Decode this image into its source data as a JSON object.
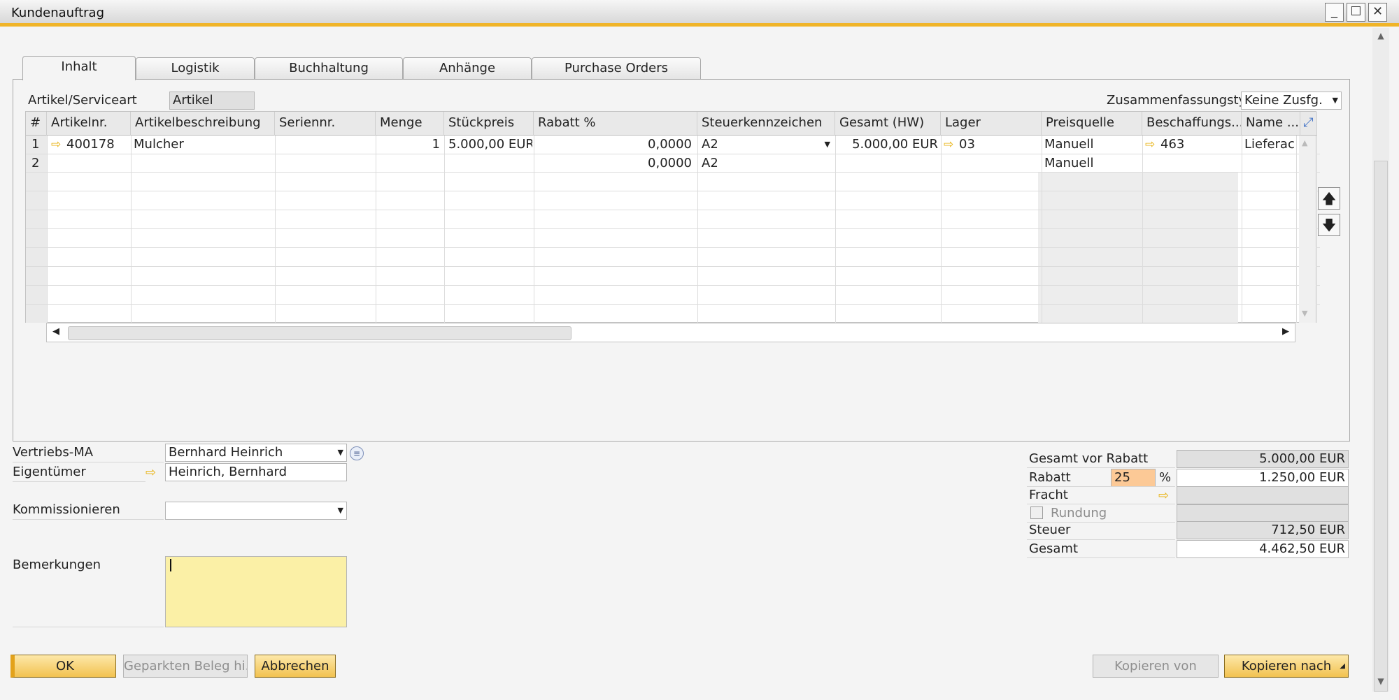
{
  "window": {
    "title": "Kundenauftrag"
  },
  "tabs": [
    {
      "label": "Inhalt"
    },
    {
      "label": "Logistik"
    },
    {
      "label": "Buchhaltung"
    },
    {
      "label": "Anhänge"
    },
    {
      "label": "Purchase Orders"
    }
  ],
  "header": {
    "item_type_label": "Artikel/Serviceart",
    "item_type_value": "Artikel",
    "summary_type_label": "Zusammenfassungstyp",
    "summary_type_value": "Keine Zusfg."
  },
  "grid": {
    "columns": [
      "#",
      "Artikelnr.",
      "Artikelbeschreibung",
      "Seriennr.",
      "Menge",
      "Stückpreis",
      "Rabatt %",
      "Steuerkennzeichen",
      "Gesamt (HW)",
      "Lager",
      "Preisquelle",
      "Beschaffungs...",
      "Name ..."
    ],
    "rows": [
      {
        "num": "1",
        "item_no": "400178",
        "description": "Mulcher",
        "serial": "",
        "qty": "1",
        "price": "5.000,00 EUR",
        "discount": "0,0000",
        "tax": "A2",
        "total": "5.000,00 EUR",
        "warehouse": "03",
        "price_source": "Manuell",
        "procurement": "463",
        "name": "Lieferac"
      },
      {
        "num": "2",
        "item_no": "",
        "description": "",
        "serial": "",
        "qty": "",
        "price": "",
        "discount": "0,0000",
        "tax": "A2",
        "total": "",
        "warehouse": "",
        "price_source": "Manuell",
        "procurement": "",
        "name": ""
      }
    ]
  },
  "footer_left": {
    "sales_employee_label": "Vertriebs-MA",
    "sales_employee_value": "Bernhard Heinrich",
    "owner_label": "Eigentümer",
    "owner_value": "Heinrich, Bernhard",
    "picking_label": "Kommissionieren",
    "picking_value": "",
    "remarks_label": "Bemerkungen",
    "remarks_value": ""
  },
  "totals": {
    "before_discount_label": "Gesamt vor Rabatt",
    "before_discount_value": "5.000,00 EUR",
    "discount_label": "Rabatt",
    "discount_percent": "25",
    "percent_sign": "%",
    "discount_value": "1.250,00 EUR",
    "freight_label": "Fracht",
    "freight_value": "",
    "rounding_label": "Rundung",
    "rounding_value": "",
    "tax_label": "Steuer",
    "tax_value": "712,50 EUR",
    "total_label": "Gesamt",
    "total_value": "4.462,50 EUR"
  },
  "buttons": {
    "ok": "OK",
    "parked": "Geparkten Beleg hi...",
    "cancel": "Abbrechen",
    "copy_from": "Kopieren von",
    "copy_to": "Kopieren nach"
  },
  "colors": {
    "accent": "#f0b428",
    "button_gold": "#f2c250",
    "remarks_bg": "#fbf0a6",
    "discount_bg": "#fcc996"
  }
}
